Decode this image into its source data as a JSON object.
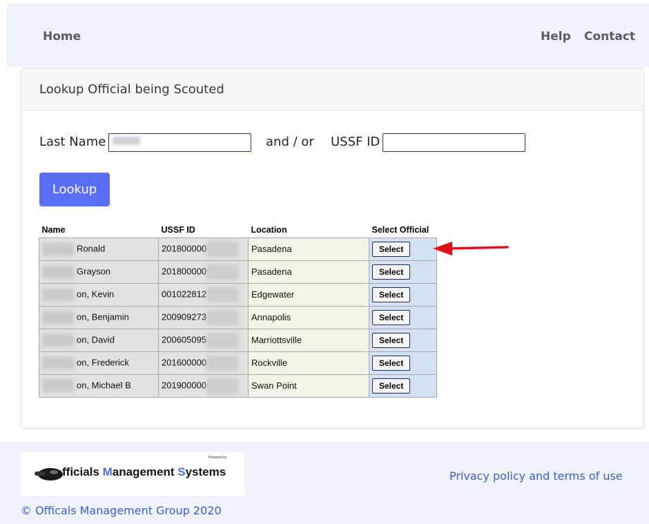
{
  "nav": {
    "home": "Home",
    "help": "Help",
    "contact": "Contact"
  },
  "card": {
    "title": "Lookup Official being Scouted"
  },
  "form": {
    "last_name_label": "Last Name",
    "last_name_value": "",
    "and_or": "and / or",
    "ussf_label": "USSF ID",
    "ussf_value": "",
    "lookup_button": "Lookup"
  },
  "table": {
    "headers": [
      "Name",
      "USSF ID",
      "Location",
      "Select Official"
    ],
    "rows": [
      {
        "name": "Ronald",
        "ussf_id": "201800000",
        "location": "Pasadena",
        "select": "Select"
      },
      {
        "name": "Grayson",
        "ussf_id": "201800000",
        "location": "Pasadena",
        "select": "Select"
      },
      {
        "name": "on, Kevin",
        "ussf_id": "001022812",
        "location": "Edgewater",
        "select": "Select"
      },
      {
        "name": "on, Benjamin",
        "ussf_id": "200909273",
        "location": "Annapolis",
        "select": "Select"
      },
      {
        "name": "on, David",
        "ussf_id": "200605095",
        "location": "Marriottsville",
        "select": "Select"
      },
      {
        "name": "on, Frederick",
        "ussf_id": "201600000",
        "location": "Rockville",
        "select": "Select"
      },
      {
        "name": "on, Michael B",
        "ussf_id": "201900000",
        "location": "Swan Point",
        "select": "Select"
      }
    ]
  },
  "annotation": {
    "arrow_color": "#e0111b"
  },
  "footer": {
    "logo_text_1": "fficials ",
    "logo_text_m": "M",
    "logo_text_2": "anagement ",
    "logo_text_s": "S",
    "logo_text_3": "ystems",
    "powered_by": "Powered by",
    "privacy": "Privacy policy and terms of use",
    "copyright": "© Officals Management Group 2020"
  },
  "colors": {
    "accent": "#5a6ef5",
    "link": "#3d5cd8",
    "nav_bg": "#eef3fa"
  }
}
